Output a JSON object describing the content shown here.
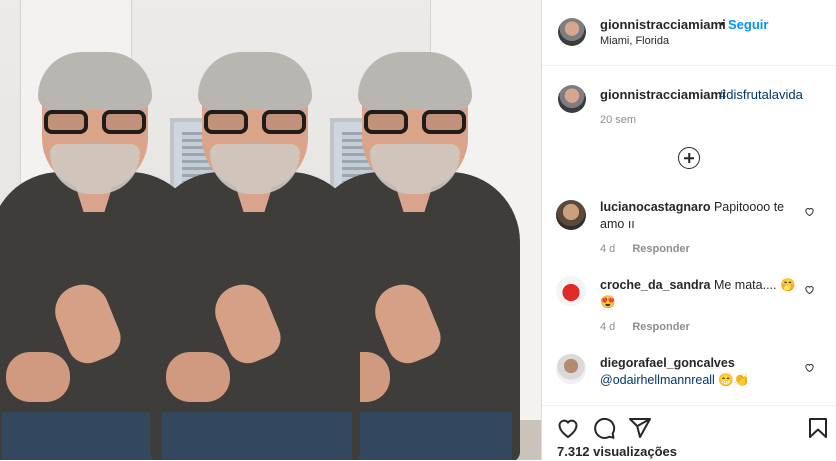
{
  "post": {
    "username": "gionnistracciamiami",
    "follow_label": "Seguir",
    "separator": "•",
    "location": "Miami, Florida"
  },
  "caption": {
    "username": "gionnistracciamiami",
    "hashtag": "#disfrutalavida",
    "age": "20 sem"
  },
  "comments": [
    {
      "username": "lucianocastagnaro",
      "text": "Papitoooo te amo",
      "emoji": "ıı",
      "age": "4 d",
      "reply_label": "Responder"
    },
    {
      "username": "croche_da_sandra",
      "text": "Me mata....",
      "emoji": "🤭 😍",
      "age": "4 d",
      "reply_label": "Responder"
    },
    {
      "username": "diegorafael_goncalves",
      "mention": "@odairhellmannreall",
      "emoji": "😁👏"
    }
  ],
  "footer": {
    "views": "7.312 visualizações"
  },
  "colors": {
    "accent": "#0095f6",
    "link": "#00376b",
    "muted": "#8e8e8e",
    "text": "#262626"
  },
  "icons": [
    "heart-icon",
    "comment-icon",
    "share-icon",
    "bookmark-icon",
    "add-comment-icon"
  ]
}
